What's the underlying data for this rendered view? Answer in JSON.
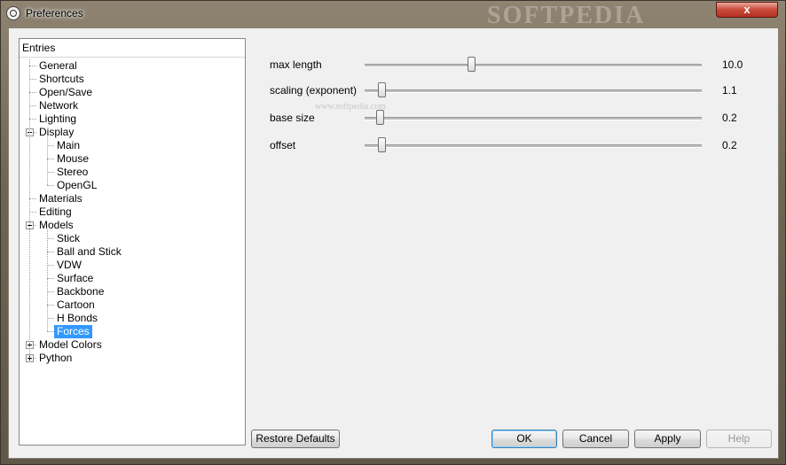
{
  "window": {
    "title": "Preferences",
    "close_label": "x",
    "watermark": "SOFTPEDIA"
  },
  "tree": {
    "header": "Entries",
    "items": [
      {
        "label": "General",
        "level": 0
      },
      {
        "label": "Shortcuts",
        "level": 0
      },
      {
        "label": "Open/Save",
        "level": 0
      },
      {
        "label": "Network",
        "level": 0
      },
      {
        "label": "Lighting",
        "level": 0
      },
      {
        "label": "Display",
        "level": 0,
        "expander": "minus"
      },
      {
        "label": "Main",
        "level": 1
      },
      {
        "label": "Mouse",
        "level": 1
      },
      {
        "label": "Stereo",
        "level": 1
      },
      {
        "label": "OpenGL",
        "level": 1
      },
      {
        "label": "Materials",
        "level": 0
      },
      {
        "label": "Editing",
        "level": 0
      },
      {
        "label": "Models",
        "level": 0,
        "expander": "minus"
      },
      {
        "label": "Stick",
        "level": 1
      },
      {
        "label": "Ball and Stick",
        "level": 1
      },
      {
        "label": "VDW",
        "level": 1
      },
      {
        "label": "Surface",
        "level": 1
      },
      {
        "label": "Backbone",
        "level": 1
      },
      {
        "label": "Cartoon",
        "level": 1
      },
      {
        "label": "H Bonds",
        "level": 1
      },
      {
        "label": "Forces",
        "level": 1,
        "selected": true
      },
      {
        "label": "Model Colors",
        "level": 0,
        "expander": "plus"
      },
      {
        "label": "Python",
        "level": 0,
        "expander": "plus"
      }
    ]
  },
  "settings": {
    "sliders": [
      {
        "label": "max length",
        "value": "10.0",
        "fraction": 0.315
      },
      {
        "label": "scaling (exponent)",
        "value": "1.1",
        "fraction": 0.05
      },
      {
        "label": "base size",
        "value": "0.2",
        "fraction": 0.045
      },
      {
        "label": "offset",
        "value": "0.2",
        "fraction": 0.05
      }
    ],
    "watermark": "www.softpedia.com"
  },
  "buttons": {
    "restore_defaults": "Restore Defaults",
    "ok": "OK",
    "cancel": "Cancel",
    "apply": "Apply",
    "help": "Help"
  },
  "colors": {
    "selection": "#3399ff",
    "close_button": "#c9493a"
  }
}
